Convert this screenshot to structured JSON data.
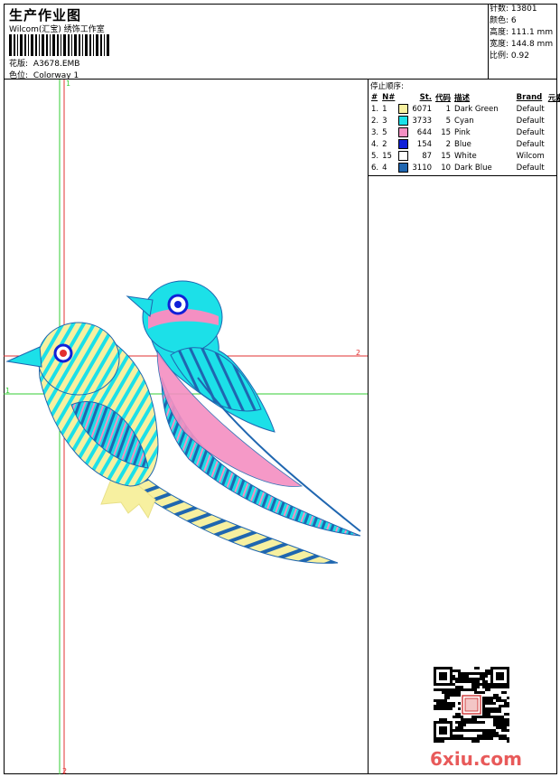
{
  "header": {
    "title": "生产作业图",
    "company": "Wilcom(汇宝) 绣饰工作室",
    "design_label": "花版:",
    "design_value": "A3678.EMB",
    "colorway_label": "色位:",
    "colorway_value": "Colorway 1"
  },
  "stats": [
    {
      "label": "针数:",
      "value": "13801"
    },
    {
      "label": "颜色:",
      "value": "6"
    },
    {
      "label": "高度:",
      "value": "111.1 mm"
    },
    {
      "label": "宽度:",
      "value": "144.8 mm"
    },
    {
      "label": "比例:",
      "value": "0.92"
    }
  ],
  "stop_sequence": {
    "caption": "停止顺序:",
    "headers": [
      "#",
      "N#",
      "St.",
      "代码",
      "描述",
      "Brand",
      "元素"
    ],
    "rows": [
      {
        "n": "1.",
        "code": "1",
        "st": "6071",
        "num": "1",
        "desc": "Dark Green",
        "brand": "Default",
        "color": "#f7f0a0"
      },
      {
        "n": "2.",
        "code": "3",
        "st": "3733",
        "num": "5",
        "desc": "Cyan",
        "brand": "Default",
        "color": "#1ce0e8"
      },
      {
        "n": "3.",
        "code": "5",
        "st": "644",
        "num": "15",
        "desc": "Pink",
        "brand": "Default",
        "color": "#f48fc2"
      },
      {
        "n": "4.",
        "code": "2",
        "st": "154",
        "num": "2",
        "desc": "Blue",
        "brand": "Default",
        "color": "#1020d8"
      },
      {
        "n": "5.",
        "code": "15",
        "st": "87",
        "num": "15",
        "desc": "White",
        "brand": "Wilcom",
        "color": "#ffffff"
      },
      {
        "n": "6.",
        "code": "4",
        "st": "3110",
        "num": "10",
        "desc": "Dark Blue",
        "brand": "Default",
        "color": "#1f66b0"
      }
    ]
  },
  "guides": {
    "v1": "1",
    "v2": "2",
    "h1": "1",
    "h2": "2"
  },
  "watermark": "6xiu.com",
  "colors": {
    "guide_green": "#33cc33",
    "guide_red": "#e23030",
    "yellow": "#f7f0a0",
    "cyan": "#1ce0e8",
    "pink": "#f48fc2",
    "blue": "#1020d8",
    "darkblue": "#1f66b0"
  }
}
